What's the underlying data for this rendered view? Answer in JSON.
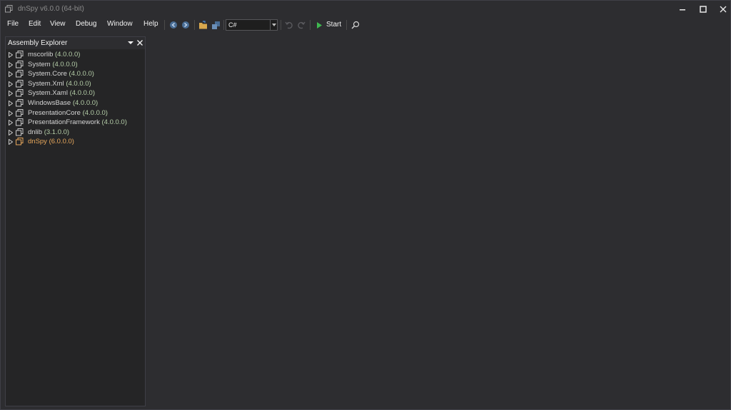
{
  "window": {
    "title": "dnSpy v6.0.0 (64-bit)"
  },
  "menu": {
    "items": [
      "File",
      "Edit",
      "View",
      "Debug",
      "Window",
      "Help"
    ]
  },
  "toolbar": {
    "language": "C#",
    "start_label": "Start"
  },
  "assembly_explorer": {
    "title": "Assembly Explorer",
    "assemblies": [
      {
        "name": "mscorlib",
        "version": "(4.0.0.0)"
      },
      {
        "name": "System",
        "version": "(4.0.0.0)"
      },
      {
        "name": "System.Core",
        "version": "(4.0.0.0)"
      },
      {
        "name": "System.Xml",
        "version": "(4.0.0.0)"
      },
      {
        "name": "System.Xaml",
        "version": "(4.0.0.0)"
      },
      {
        "name": "WindowsBase",
        "version": "(4.0.0.0)"
      },
      {
        "name": "PresentationCore",
        "version": "(4.0.0.0)"
      },
      {
        "name": "PresentationFramework",
        "version": "(4.0.0.0)"
      },
      {
        "name": "dnlib",
        "version": "(3.1.0.0)"
      },
      {
        "name": "dnSpy",
        "version": "(6.0.0.0)"
      }
    ]
  },
  "colors": {
    "background": "#2d2d30",
    "panel": "#252526",
    "version_green": "#b5cea8",
    "highlight_orange": "#e8a85c",
    "start_green": "#3fb950",
    "nav_blue": "#4a90d9"
  }
}
